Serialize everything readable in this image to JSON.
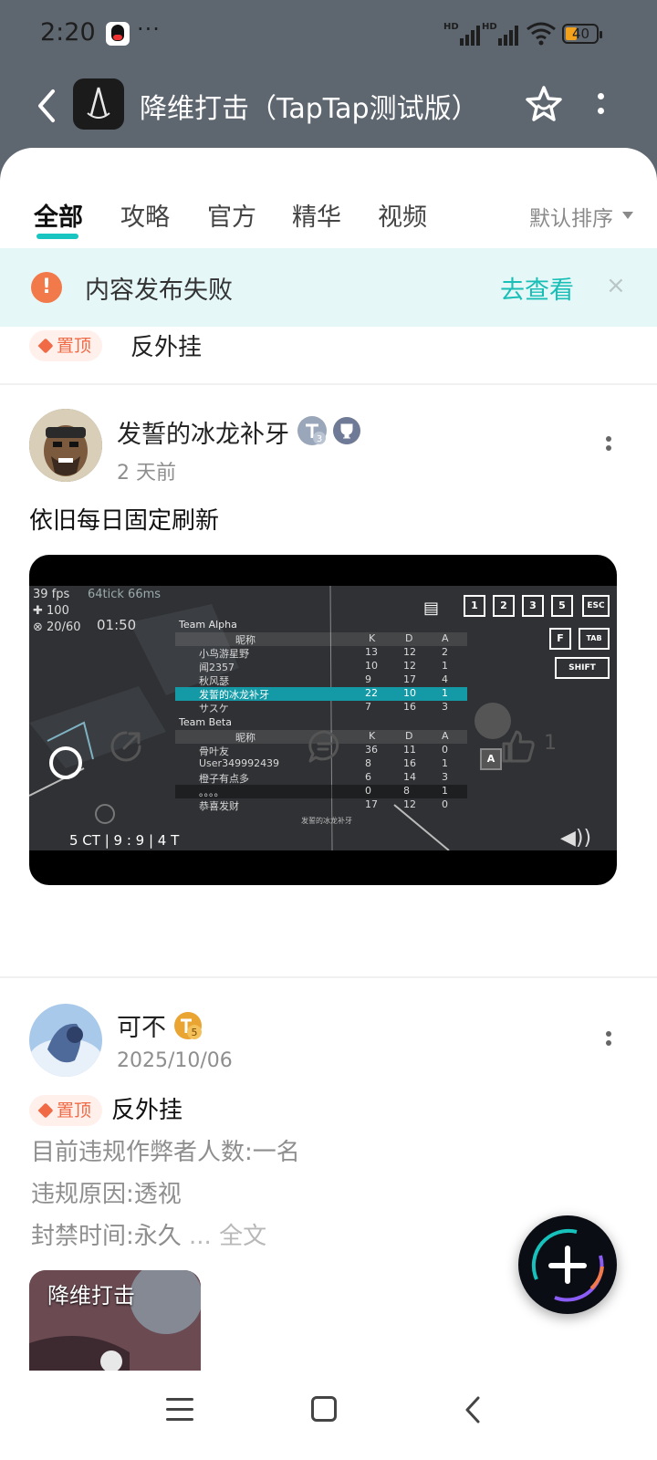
{
  "status_bar": {
    "time": "2:20",
    "dots": "···",
    "network_1": "HD",
    "network_2": "HD",
    "battery": "40"
  },
  "app_bar": {
    "title": "降维打击（TapTap测试版）"
  },
  "tabs": [
    {
      "label": "全部",
      "active": true
    },
    {
      "label": "攻略"
    },
    {
      "label": "官方"
    },
    {
      "label": "精华"
    },
    {
      "label": "视频"
    }
  ],
  "sort": {
    "label": "默认排序"
  },
  "banner": {
    "message": "内容发布失败",
    "action": "去查看",
    "close": "×"
  },
  "pinned": {
    "badge": "置顶",
    "title": "反外挂"
  },
  "post1": {
    "author": "发誓的冰龙补牙",
    "level": "3",
    "time": "2 天前",
    "content": "依旧每日固定刷新",
    "like_count": "1",
    "video": {
      "fps": "39 fps",
      "tick": "64tick 66ms",
      "hp": "100",
      "ammo": "20/60",
      "timer": "01:50",
      "footer": "5 CT | 9 : 9 | 4 T",
      "team_alpha": "Team Alpha",
      "team_beta": "Team Beta",
      "col_name": "昵称",
      "col_k": "K",
      "col_d": "D",
      "col_a": "A",
      "alpha_rows": [
        {
          "name": "小鸟游星野",
          "k": "13",
          "d": "12",
          "a": "2"
        },
        {
          "name": "闻2357",
          "k": "10",
          "d": "12",
          "a": "1"
        },
        {
          "name": "秋风瑟",
          "k": "9",
          "d": "17",
          "a": "4"
        },
        {
          "name": "发誓的冰龙补牙",
          "k": "22",
          "d": "10",
          "a": "1"
        },
        {
          "name": "サスケ",
          "k": "7",
          "d": "16",
          "a": "3"
        }
      ],
      "beta_rows": [
        {
          "name": "骨叶友",
          "k": "36",
          "d": "11",
          "a": "0"
        },
        {
          "name": "User349992439",
          "k": "8",
          "d": "16",
          "a": "1"
        },
        {
          "name": "橙子有点多",
          "k": "6",
          "d": "14",
          "a": "3"
        },
        {
          "name": "。。。。",
          "k": "0",
          "d": "8",
          "a": "1"
        },
        {
          "name": "恭喜发财",
          "k": "17",
          "d": "12",
          "a": "0"
        }
      ],
      "keys": [
        "1",
        "2",
        "3",
        "5",
        "ESC"
      ],
      "key_f": "F",
      "key_tab": "TAB",
      "key_shift": "SHIFT",
      "key_a": "A",
      "caption": "发誓的冰龙补牙"
    }
  },
  "post2": {
    "author": "可不",
    "level": "5",
    "time": "2025/10/06",
    "badge": "置顶",
    "title": "反外挂",
    "lines": [
      "目前违规作弊者人数:一名",
      "违规原因:透视",
      "封禁时间:永久"
    ],
    "more": "... 全文",
    "thumb_label": "降维打击"
  },
  "colors": {
    "accent": "#19c5c0",
    "warning": "#f2794a",
    "pin": "#f06a45",
    "header_bg": "#5e6670"
  }
}
